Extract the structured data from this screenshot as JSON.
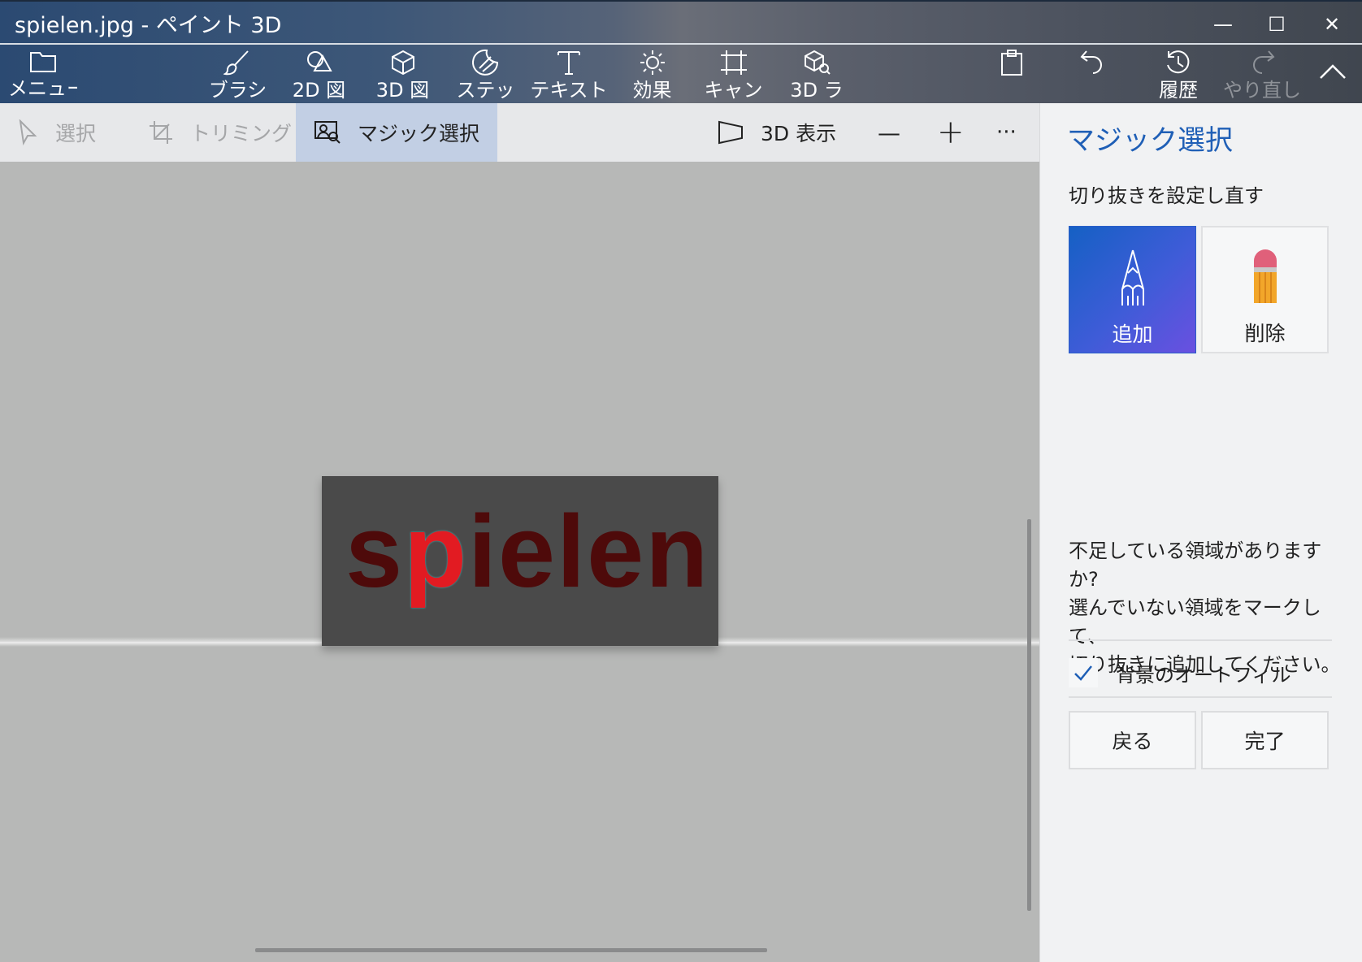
{
  "window": {
    "title": "spielen.jpg - ペイント 3D",
    "controls": {
      "minimize": "—",
      "maximize": "☐",
      "close": "✕"
    }
  },
  "toolbar": {
    "menu": "メニュー",
    "brushes": "ブラシ",
    "shapes2d": "2D 図",
    "shapes3d": "3D 図",
    "stickers": "ステッ",
    "text": "テキスト",
    "effects": "効果",
    "canvas": "キャン",
    "library3d": "3D ラ",
    "history": "履歴",
    "redo": "やり直し"
  },
  "subtoolbar": {
    "select": "選択",
    "crop": "トリミング",
    "magic_select": "マジック選択",
    "view3d": "3D 表示",
    "zoom_out": "—",
    "zoom_in": "+",
    "more": "···"
  },
  "canvas": {
    "text_pre": "s",
    "text_sel": "p",
    "text_post": "ielen",
    "selected_color": "#e21b22",
    "text_color": "#4e0a0a"
  },
  "panel": {
    "title": "マジック選択",
    "subtitle": "切り抜きを設定し直す",
    "add": "追加",
    "remove": "削除",
    "hint_1": "不足している領域がありますか?",
    "hint_2": "選んでいない領域をマークして、",
    "hint_3": "切り抜きに追加してください。",
    "autofill_label": "背景のオートフィル",
    "autofill_checked": true,
    "back": "戻る",
    "done": "完了",
    "accent": "#1f5fb6"
  }
}
